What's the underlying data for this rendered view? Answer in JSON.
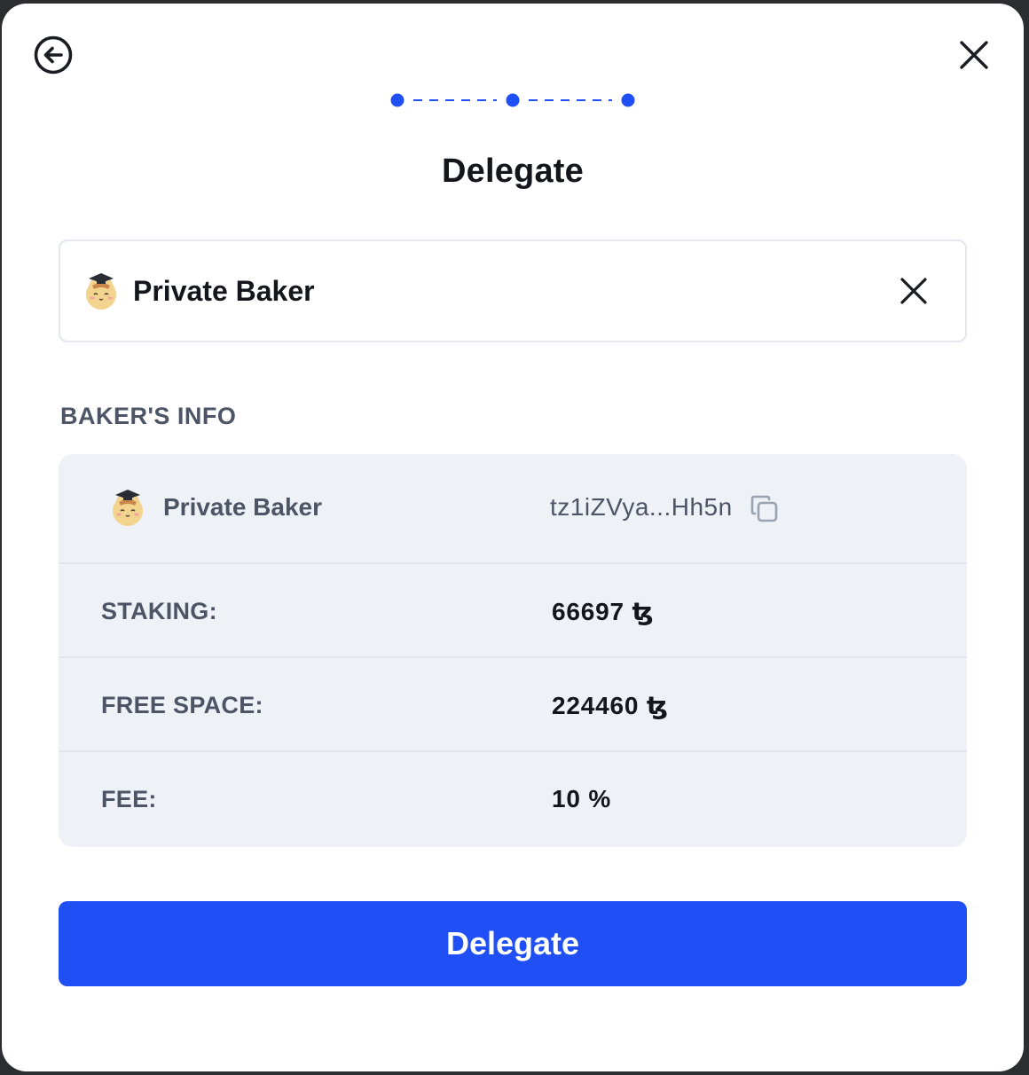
{
  "header": {
    "title": "Delegate",
    "back_icon": "arrow-left-circle-icon",
    "close_icon": "close-icon",
    "stepper": {
      "total_steps": 3,
      "current_step": 3,
      "color": "#1f4ff5"
    }
  },
  "selected_baker": {
    "name": "Private Baker",
    "avatar_icon": "cat-graduate-avatar-icon",
    "clear_icon": "close-icon"
  },
  "baker_info": {
    "section_label": "BAKER'S INFO",
    "baker_name": "Private Baker",
    "address": "tz1iZVya...Hh5n",
    "copy_icon": "copy-icon",
    "rows": [
      {
        "label": "STAKING:",
        "value": "66697 ꜩ"
      },
      {
        "label": "FREE SPACE:",
        "value": "224460 ꜩ"
      },
      {
        "label": "FEE:",
        "value": "10 %"
      }
    ]
  },
  "actions": {
    "delegate_label": "Delegate",
    "primary_color": "#1f4ff5"
  }
}
